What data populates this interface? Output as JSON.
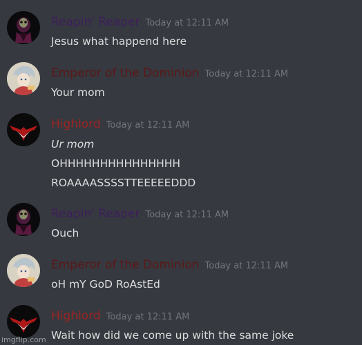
{
  "colors": {
    "background": "#36393f",
    "timestamp": "#72767d",
    "text": "#dcddde",
    "reaper_name": "#3d1f5c",
    "emperor_name": "#5c1717",
    "highlord_name": "#9b2424"
  },
  "messages": [
    {
      "avatar_icon": "reaper-skull-avatar-icon",
      "username": "Reapin' Reaper",
      "timestamp": "Today at 12:11 AM",
      "lines": [
        "Jesus what happend here"
      ]
    },
    {
      "avatar_icon": "anime-character-avatar-icon",
      "username": "Emperor of the Dominion",
      "timestamp": "Today at 12:11 AM",
      "lines": [
        "Your mom"
      ]
    },
    {
      "avatar_icon": "red-eagle-emblem-avatar-icon",
      "username": "Highlord",
      "timestamp": "Today at 12:11 AM",
      "lines": [
        "Ur mom",
        "OHHHHHHHHHHHHHHH",
        "ROAAAASSSSTTEEEEEDDD"
      ]
    },
    {
      "avatar_icon": "reaper-skull-avatar-icon",
      "username": "Reapin' Reaper",
      "timestamp": "Today at 12:11 AM",
      "lines": [
        "Ouch"
      ]
    },
    {
      "avatar_icon": "anime-character-avatar-icon",
      "username": "Emperor of the Dominion",
      "timestamp": "Today at 12:11 AM",
      "lines": [
        "oH mY GoD RoAstEd"
      ]
    },
    {
      "avatar_icon": "red-eagle-emblem-avatar-icon",
      "username": "Highlord",
      "timestamp": "Today at 12:11 AM",
      "lines": [
        "Wait how did we come up with the same joke"
      ]
    }
  ],
  "watermark": "imgflip.com"
}
